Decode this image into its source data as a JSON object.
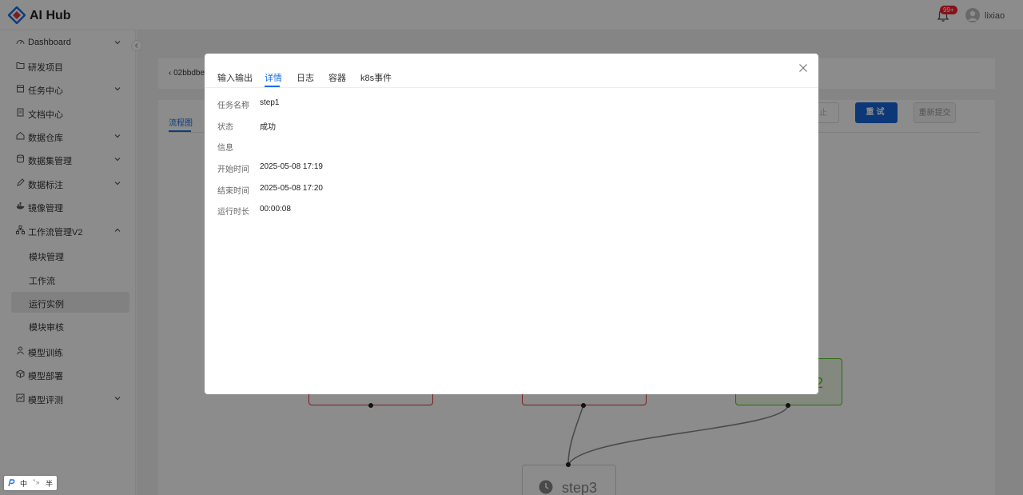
{
  "header": {
    "brand": "AI Hub",
    "notification_badge": "99+",
    "username": "lixiao"
  },
  "sidebar": {
    "items": [
      {
        "label": "Dashboard",
        "icon": "dashboard-icon",
        "expandable": true
      },
      {
        "label": "研发项目",
        "icon": "folder-icon",
        "expandable": false
      },
      {
        "label": "任务中心",
        "icon": "calendar-icon",
        "expandable": true
      },
      {
        "label": "文档中心",
        "icon": "document-icon",
        "expandable": false
      },
      {
        "label": "数据仓库",
        "icon": "home-icon",
        "expandable": true
      },
      {
        "label": "数据集管理",
        "icon": "database-icon",
        "expandable": true
      },
      {
        "label": "数据标注",
        "icon": "pen-icon",
        "expandable": true
      },
      {
        "label": "镜像管理",
        "icon": "docker-icon",
        "expandable": false
      },
      {
        "label": "工作流管理V2",
        "icon": "workflow-icon",
        "expandable": true,
        "expanded": true
      }
    ],
    "subitems": [
      {
        "label": "模块管理"
      },
      {
        "label": "工作流"
      },
      {
        "label": "运行实例",
        "active": true
      },
      {
        "label": "模块审核"
      }
    ],
    "bottom_items": [
      {
        "label": "模型训练",
        "icon": "training-icon",
        "expandable": false
      },
      {
        "label": "模型部署",
        "icon": "cube-icon",
        "expandable": false
      },
      {
        "label": "模型评测",
        "icon": "chart-icon",
        "expandable": true
      }
    ]
  },
  "background_page": {
    "breadcrumb": "02bbdbe",
    "tab_label": "流程图",
    "stop_button": "止",
    "retry_button": "重试",
    "resubmit_button": "重新提交",
    "nodes": {
      "green_node_text": "2",
      "step3_label": "step3"
    }
  },
  "modal": {
    "tabs": [
      {
        "label": "输入输出"
      },
      {
        "label": "详情",
        "active": true
      },
      {
        "label": "日志"
      },
      {
        "label": "容器"
      },
      {
        "label": "k8s事件"
      }
    ],
    "details": [
      {
        "label": "任务名称",
        "value": "step1"
      },
      {
        "label": "状态",
        "value": "成功"
      },
      {
        "label": "信息",
        "value": ""
      },
      {
        "label": "开始时间",
        "value": "2025-05-08 17:19"
      },
      {
        "label": "结束时间",
        "value": "2025-05-08 17:20"
      },
      {
        "label": "运行时长",
        "value": "00:00:08"
      }
    ]
  },
  "ime": {
    "lang": "中",
    "punct": "°»",
    "width": "半"
  },
  "colors": {
    "primary": "#1a6fe0",
    "node_error": "#e0383e",
    "node_success": "#52c41a",
    "badge": "#f5222d"
  }
}
